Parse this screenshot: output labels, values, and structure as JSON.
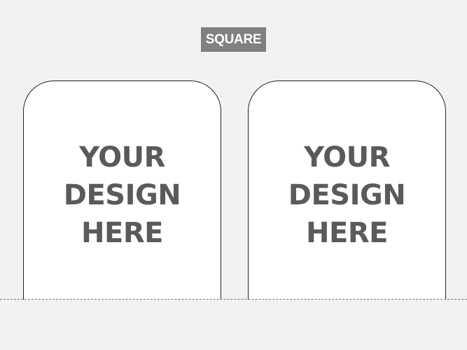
{
  "shape_label": "SQUARE",
  "panels": [
    {
      "lines": [
        "YOUR",
        "DESIGN",
        "HERE"
      ]
    },
    {
      "lines": [
        "YOUR",
        "DESIGN",
        "HERE"
      ]
    }
  ],
  "colors": {
    "background": "#f2f2f2",
    "badge": "#808080",
    "text": "#5a5a5a",
    "panel": "#ffffff"
  }
}
